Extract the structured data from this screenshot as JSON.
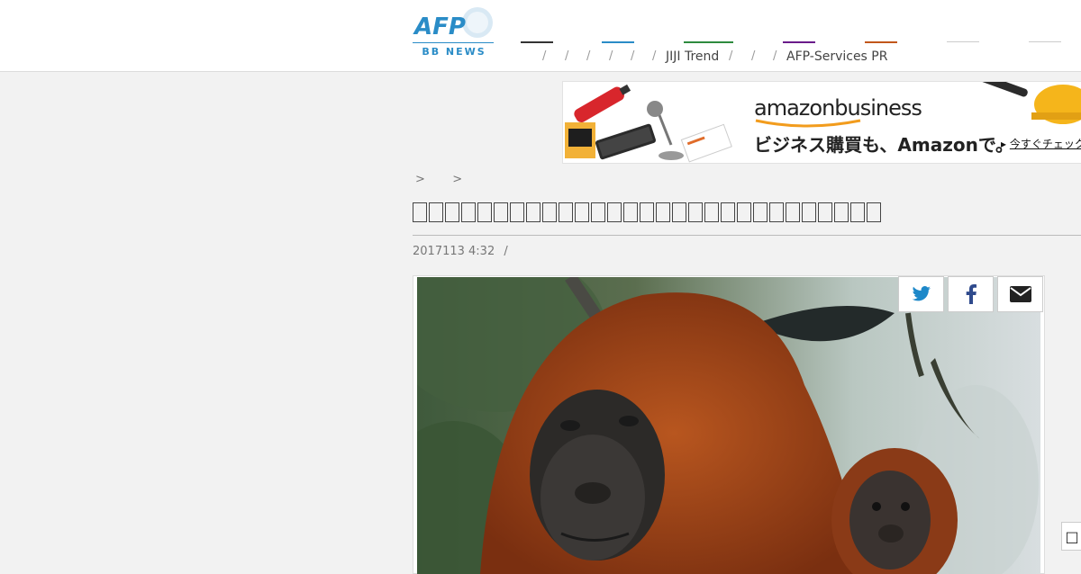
{
  "header": {
    "logo_text": "AFP",
    "logo_sub": "BB NEWS",
    "nav_sep": "/",
    "nav_jiji": "JIJI Trend",
    "nav_services": "AFP-Services PR",
    "nav_colors": [
      "#333333",
      "#2a8cc7",
      "#2e8b3e",
      "#6a1b8a",
      "#c2571a",
      "#cccccc",
      "#cccccc"
    ]
  },
  "ad": {
    "brand": "amazonbusiness",
    "tagline": "ビジネス購買も、Amazonで。",
    "cta": "今すぐチェック"
  },
  "breadcrumb": {
    "sep1": ">",
    "sep2": ">"
  },
  "article": {
    "title": "",
    "date": "2017113 4:32",
    "date_sep": "/"
  },
  "share": {
    "twitter_icon": "twitter-icon",
    "facebook_icon": "facebook-icon",
    "mail_icon": "envelope-icon"
  }
}
